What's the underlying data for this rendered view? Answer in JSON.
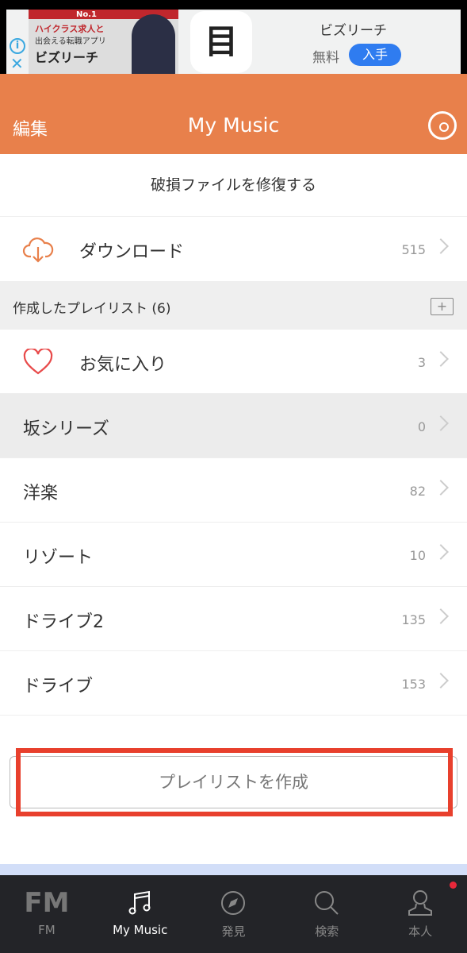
{
  "ad": {
    "image_heading": "No.1",
    "image_line1": "ハイクラス求人と",
    "image_line2": "出会える転職アプリ",
    "image_line3": "ビズリーチ",
    "app_icon_glyph": "目",
    "app_name": "ビズリーチ",
    "price": "無料",
    "get_label": "入手"
  },
  "header": {
    "edit": "編集",
    "title": "My Music",
    "accent": "#e8804b"
  },
  "repair": "破損ファイルを修復する",
  "download": {
    "label": "ダウンロード",
    "count": "515"
  },
  "section": {
    "label": "作成したプレイリスト (6)"
  },
  "favorites": {
    "label": "お気に入り",
    "count": "3"
  },
  "playlists": [
    {
      "label": "坂シリーズ",
      "count": "0",
      "highlighted": true
    },
    {
      "label": "洋楽",
      "count": "82"
    },
    {
      "label": "リゾート",
      "count": "10"
    },
    {
      "label": "ドライブ2",
      "count": "135"
    },
    {
      "label": "ドライブ",
      "count": "153"
    }
  ],
  "create_button": "プレイリストを作成",
  "tabs": [
    {
      "label": "FM",
      "icon": "FM"
    },
    {
      "label": "My Music",
      "icon": "music-note-icon",
      "active": true
    },
    {
      "label": "発見",
      "icon": "compass-icon"
    },
    {
      "label": "検索",
      "icon": "search-icon"
    },
    {
      "label": "本人",
      "icon": "person-icon",
      "badge": true
    }
  ]
}
